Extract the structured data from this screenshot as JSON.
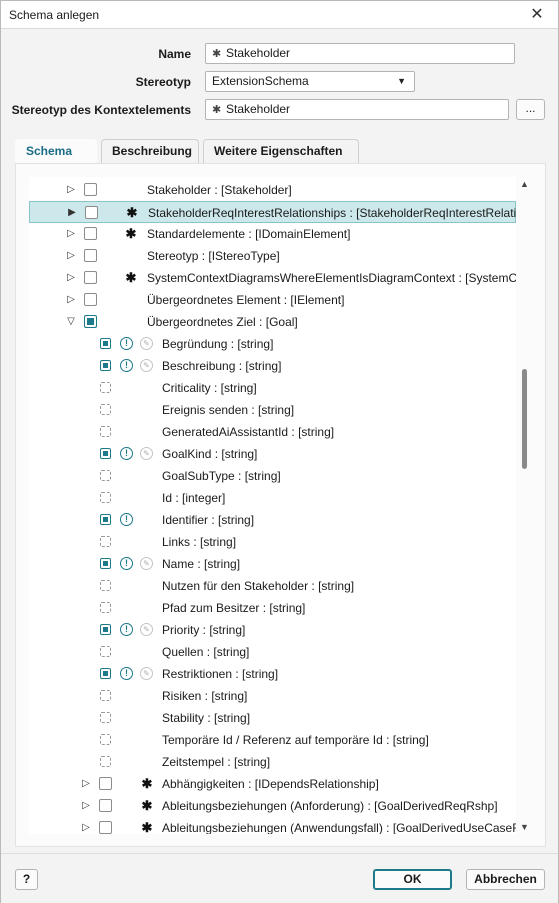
{
  "window": {
    "title": "Schema anlegen"
  },
  "form": {
    "name_label": "Name",
    "name_value": "Stakeholder",
    "stereotype_label": "Stereotyp",
    "stereotype_value": "ExtensionSchema",
    "context_stereotype_label": "Stereotyp des Kontextelements",
    "context_stereotype_value": "Stakeholder",
    "browse_label": "..."
  },
  "tabs": [
    {
      "label": "Schema",
      "active": true
    },
    {
      "label": "Beschreibung",
      "active": false
    },
    {
      "label": "Weitere Eigenschaften",
      "active": false
    }
  ],
  "tree": {
    "top_rows": [
      {
        "label": "Stakeholder : [Stakeholder]",
        "expander": "collapsed",
        "checked": false,
        "asterisk": false,
        "selected": false
      },
      {
        "label": "StakeholderReqInterestRelationships : [StakeholderReqInterestRelatic",
        "expander": "collapsed",
        "checked": false,
        "asterisk": true,
        "selected": true
      },
      {
        "label": "Standardelemente : [IDomainElement]",
        "expander": "collapsed",
        "checked": false,
        "asterisk": true,
        "selected": false
      },
      {
        "label": "Stereotyp : [IStereoType]",
        "expander": "collapsed",
        "checked": false,
        "asterisk": false,
        "selected": false
      },
      {
        "label": "SystemContextDiagramsWhereElementIsDiagramContext : [SystemCor",
        "expander": "collapsed",
        "checked": false,
        "asterisk": true,
        "selected": false
      },
      {
        "label": "Übergeordnetes Element : [IElement]",
        "expander": "collapsed",
        "checked": false,
        "asterisk": false,
        "selected": false
      },
      {
        "label": "Übergeordnetes Ziel : [Goal]",
        "expander": "expanded",
        "checked": true,
        "asterisk": false,
        "selected": false
      }
    ],
    "child_rows": [
      {
        "label": "Begründung : [string]",
        "checked": true,
        "required": true,
        "readonly": true
      },
      {
        "label": "Beschreibung : [string]",
        "checked": true,
        "required": true,
        "readonly": true
      },
      {
        "label": "Criticality : [string]",
        "checked": false,
        "required": false,
        "readonly": false
      },
      {
        "label": "Ereignis senden : [string]",
        "checked": false,
        "required": false,
        "readonly": false
      },
      {
        "label": "GeneratedAiAssistantId : [string]",
        "checked": false,
        "required": false,
        "readonly": false
      },
      {
        "label": "GoalKind : [string]",
        "checked": true,
        "required": true,
        "readonly": true
      },
      {
        "label": "GoalSubType : [string]",
        "checked": false,
        "required": false,
        "readonly": false
      },
      {
        "label": "Id : [integer]",
        "checked": false,
        "required": false,
        "readonly": false
      },
      {
        "label": "Identifier : [string]",
        "checked": true,
        "required": true,
        "readonly": false
      },
      {
        "label": "Links : [string]",
        "checked": false,
        "required": false,
        "readonly": false
      },
      {
        "label": "Name : [string]",
        "checked": true,
        "required": true,
        "readonly": true
      },
      {
        "label": "Nutzen für den Stakeholder : [string]",
        "checked": false,
        "required": false,
        "readonly": false
      },
      {
        "label": "Pfad zum Besitzer : [string]",
        "checked": false,
        "required": false,
        "readonly": false
      },
      {
        "label": "Priority : [string]",
        "checked": true,
        "required": true,
        "readonly": true
      },
      {
        "label": "Quellen : [string]",
        "checked": false,
        "required": false,
        "readonly": false
      },
      {
        "label": "Restriktionen : [string]",
        "checked": true,
        "required": true,
        "readonly": true
      },
      {
        "label": "Risiken : [string]",
        "checked": false,
        "required": false,
        "readonly": false
      },
      {
        "label": "Stability : [string]",
        "checked": false,
        "required": false,
        "readonly": false
      },
      {
        "label": "Temporäre Id / Referenz auf temporäre Id : [string]",
        "checked": false,
        "required": false,
        "readonly": false
      },
      {
        "label": "Zeitstempel : [string]",
        "checked": false,
        "required": false,
        "readonly": false
      }
    ],
    "nested_rows": [
      {
        "label": "Abhängigkeiten : [IDependsRelationship]",
        "checked": false,
        "asterisk": true
      },
      {
        "label": "Ableitungsbeziehungen (Anforderung) : [GoalDerivedReqRshp]",
        "checked": false,
        "asterisk": true
      },
      {
        "label": "Ableitungsbeziehungen (Anwendungsfall) : [GoalDerivedUseCaseRs",
        "checked": false,
        "asterisk": true
      }
    ]
  },
  "footer": {
    "help_label": "?",
    "ok_label": "OK",
    "cancel_label": "Abbrechen"
  },
  "icons": {
    "close": "close-icon",
    "expand_collapsed": "chevron-right-icon",
    "expand_expanded": "chevron-down-icon",
    "selected_expander": "chevron-right-filled-icon",
    "required": "exclamation-circle-icon",
    "readonly": "pencil-disabled-icon",
    "asterisk": "asterisk-icon"
  },
  "colors": {
    "accent": "#1c7a8a",
    "selection": "#cde8ea",
    "tab_active_text": "#1a6b86"
  }
}
